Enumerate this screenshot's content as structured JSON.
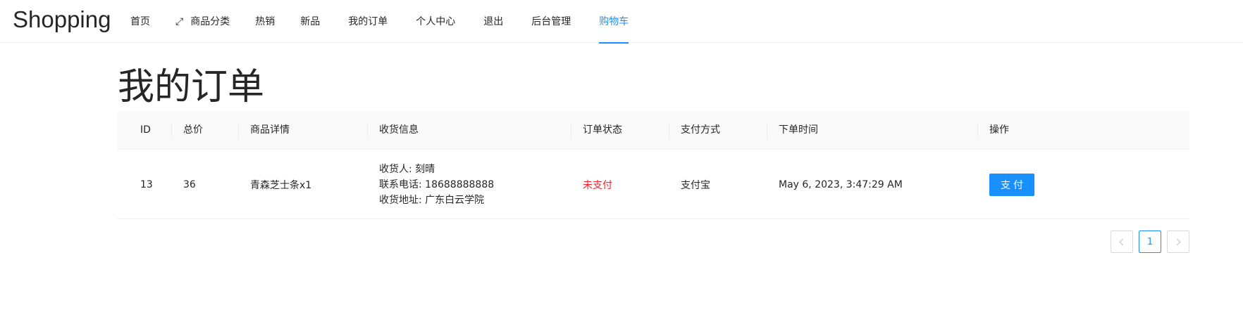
{
  "header": {
    "brand": "Shopping",
    "nav": [
      {
        "label": "首页",
        "active": false
      },
      {
        "label": "商品分类",
        "icon": "expand-arrows-icon",
        "active": false
      },
      {
        "label": "热销",
        "active": false
      },
      {
        "label": "新品",
        "active": false
      },
      {
        "label": "我的订单",
        "active": false
      },
      {
        "label": "个人中心",
        "active": false
      },
      {
        "label": "退出",
        "active": false
      },
      {
        "label": "后台管理",
        "active": false
      },
      {
        "label": "购物车",
        "active": true
      }
    ]
  },
  "page": {
    "title": "我的订单"
  },
  "table": {
    "columns": [
      "ID",
      "总价",
      "商品详情",
      "收货信息",
      "订单状态",
      "支付方式",
      "下单时间",
      "操作"
    ],
    "rows": [
      {
        "id": "13",
        "total": "36",
        "product": "青森芝士条x1",
        "receiver": "收货人: 刻晴",
        "phone": "联系电话: 18688888888",
        "address": "收货地址: 广东白云学院",
        "status": "未支付",
        "payment": "支付宝",
        "time": "May 6, 2023, 3:47:29 AM",
        "action": "支付"
      }
    ]
  },
  "pagination": {
    "current": "1"
  },
  "colors": {
    "accent": "#1890ff",
    "danger": "#f5222d"
  }
}
